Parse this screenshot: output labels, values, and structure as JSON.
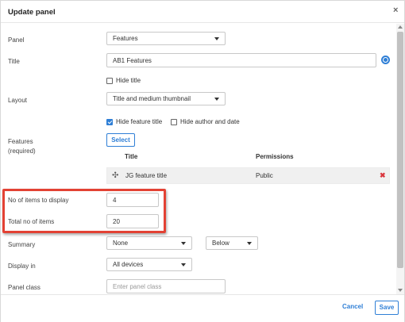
{
  "dialog": {
    "title": "Update panel",
    "close_glyph": "×"
  },
  "form": {
    "panel": {
      "label": "Panel",
      "value": "Features"
    },
    "title": {
      "label": "Title",
      "value": "AB1 Features",
      "icon": "globe-icon"
    },
    "hide_title": {
      "label": "Hide title",
      "checked": false
    },
    "layout": {
      "label": "Layout",
      "value": "Title and medium thumbnail"
    },
    "hide_feature_title": {
      "label": "Hide feature title",
      "checked": true
    },
    "hide_author_date": {
      "label": "Hide author and date",
      "checked": false
    },
    "features": {
      "label_line1": "Features",
      "label_line2": "(required)",
      "select_button": "Select",
      "columns": [
        "Title",
        "Permissions"
      ],
      "rows": [
        {
          "drag_glyph": "✣",
          "title": "JG feature title",
          "permissions": "Public",
          "delete_glyph": "✖"
        }
      ]
    },
    "items_to_display": {
      "label": "No of items to display",
      "value": "4"
    },
    "total_items": {
      "label": "Total no of items",
      "value": "20"
    },
    "summary": {
      "label": "Summary",
      "value": "None",
      "position": "Below"
    },
    "display_in": {
      "label": "Display in",
      "value": "All devices"
    },
    "panel_class": {
      "label": "Panel class",
      "placeholder": "Enter panel class"
    }
  },
  "footer": {
    "cancel_label": "Cancel",
    "save_label": "Save"
  },
  "colors": {
    "accent": "#2f7fd6",
    "highlight": "#e34234",
    "delete": "#d9363e"
  }
}
